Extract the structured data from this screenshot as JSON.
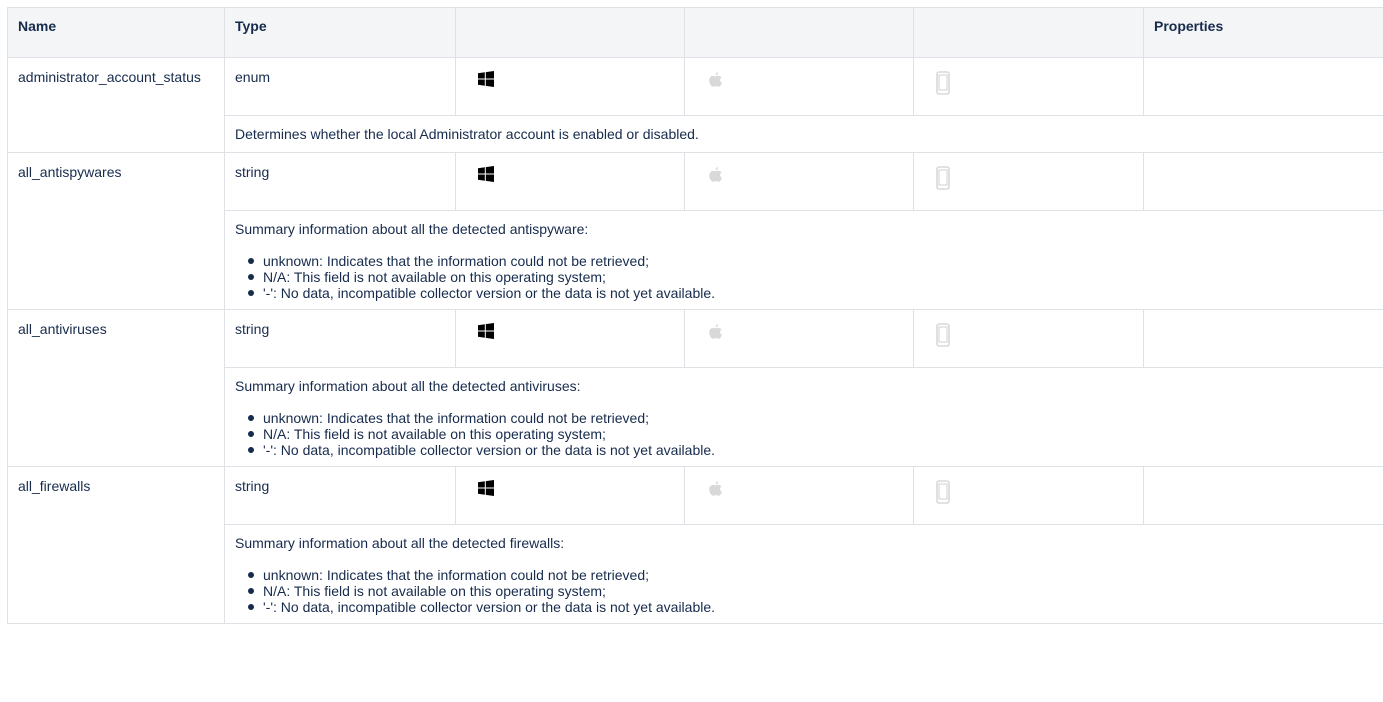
{
  "headers": {
    "name": "Name",
    "type": "Type",
    "col3": "",
    "col4": "",
    "col5": "",
    "properties": "Properties"
  },
  "platform_icons": [
    "windows-icon",
    "apple-icon",
    "mobile-icon"
  ],
  "colors": {
    "windows_icon": "#000000",
    "disabled_icon": "#d9d9d9",
    "border": "#dfe1e6",
    "header_bg": "#f4f5f7",
    "text": "#172b4d"
  },
  "rows": [
    {
      "name": "administrator_account_status",
      "type": "enum",
      "properties": "",
      "description": "Determines whether the local Administrator account is enabled or disabled.",
      "options": []
    },
    {
      "name": "all_antispywares",
      "type": "string",
      "properties": "",
      "description": "Summary information about all the detected antispyware:",
      "options": [
        "unknown: Indicates that the information could not be retrieved;",
        "N/A: This field is not available on this operating system;",
        "'-': No data, incompatible collector version or the data is not yet available."
      ]
    },
    {
      "name": "all_antiviruses",
      "type": "string",
      "properties": "",
      "description": "Summary information about all the detected antiviruses:",
      "options": [
        "unknown: Indicates that the information could not be retrieved;",
        "N/A: This field is not available on this operating system;",
        "'-': No data, incompatible collector version or the data is not yet available."
      ]
    },
    {
      "name": "all_firewalls",
      "type": "string",
      "properties": "",
      "description": "Summary information about all the detected firewalls:",
      "options": [
        "unknown: Indicates that the information could not be retrieved;",
        "N/A: This field is not available on this operating system;",
        "'-': No data, incompatible collector version or the data is not yet available."
      ]
    }
  ]
}
